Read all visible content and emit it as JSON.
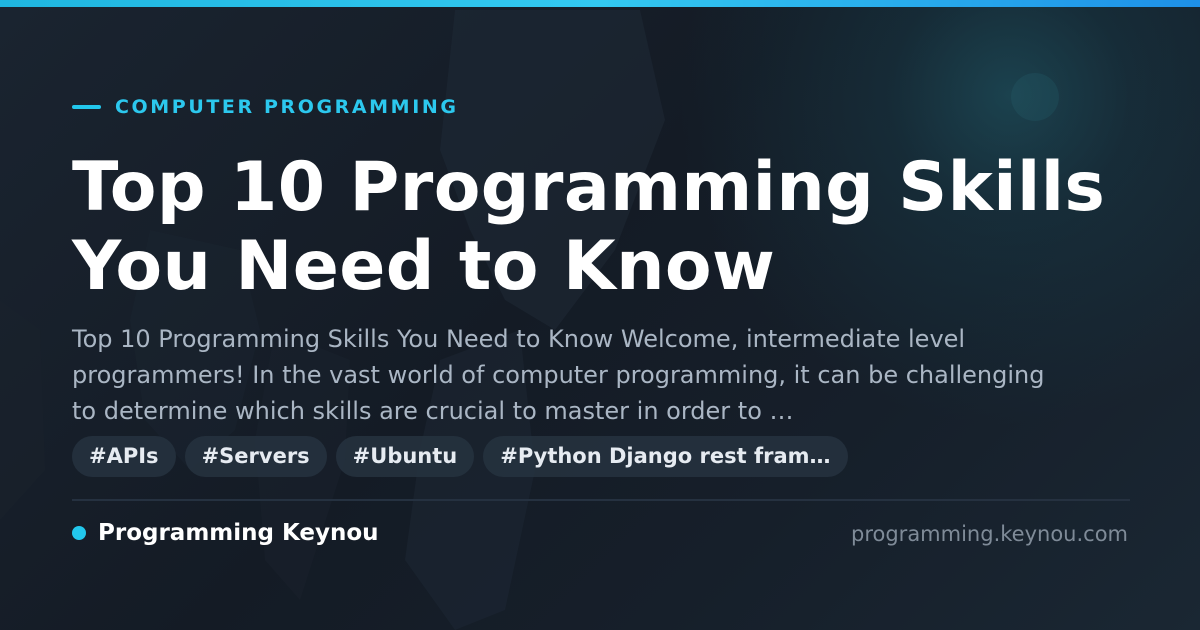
{
  "category": "COMPUTER PROGRAMMING",
  "title": "Top 10 Programming Skills You Need to Know",
  "description": "Top 10 Programming Skills You Need to Know Welcome, intermediate level programmers! In the vast world of computer programming, it can be challenging to determine which skills are crucial to master in order to …",
  "tags": [
    {
      "label": "#APIs"
    },
    {
      "label": "#Servers"
    },
    {
      "label": "#Ubuntu"
    },
    {
      "label": "#Python Django rest fram…"
    }
  ],
  "brand": {
    "name": "Programming Keynou",
    "url": "programming.keynou.com"
  },
  "colors": {
    "accent": "#22c7ec",
    "background": "#151c26",
    "title": "#ffffff",
    "description": "#aab6c4",
    "url": "#7f8b98"
  }
}
